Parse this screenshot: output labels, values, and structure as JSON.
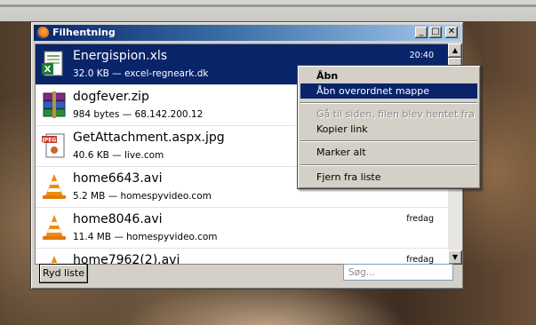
{
  "window": {
    "title": "Filhentning"
  },
  "downloads": [
    {
      "name": "Energispion.xls",
      "meta": "32.0 KB — excel-regneark.dk",
      "time": "20:40",
      "icon": "excel-file-icon",
      "selected": true
    },
    {
      "name": "dogfever.zip",
      "meta": "984 bytes — 68.142.200.12",
      "time": "",
      "icon": "winrar-archive-icon",
      "selected": false
    },
    {
      "name": "GetAttachment.aspx.jpg",
      "meta": "40.6 KB — live.com",
      "time": "",
      "icon": "jpeg-file-icon",
      "selected": false
    },
    {
      "name": "home6643.avi",
      "meta": "5.2 MB — homespyvideo.com",
      "time": "",
      "icon": "vlc-cone-icon",
      "selected": false
    },
    {
      "name": "home8046.avi",
      "meta": "11.4 MB — homespyvideo.com",
      "time": "fredag",
      "icon": "vlc-cone-icon",
      "selected": false
    },
    {
      "name": "home7962(2).avi",
      "meta": "",
      "time": "fredag",
      "icon": "vlc-cone-icon",
      "selected": false
    }
  ],
  "context_menu": {
    "items": [
      {
        "label": "Åbn",
        "bold": true,
        "highlighted": false,
        "disabled": false
      },
      {
        "label": "Åbn overordnet mappe",
        "bold": false,
        "highlighted": true,
        "disabled": false
      },
      {
        "label": "Gå til siden, filen blev hentet fra",
        "bold": false,
        "highlighted": false,
        "disabled": true
      },
      {
        "label": "Kopier link",
        "bold": false,
        "highlighted": false,
        "disabled": false
      },
      {
        "label": "Marker alt",
        "bold": false,
        "highlighted": false,
        "disabled": false
      },
      {
        "label": "Fjern fra liste",
        "bold": false,
        "highlighted": false,
        "disabled": false
      }
    ]
  },
  "toolbar": {
    "clear_label": "Ryd liste"
  },
  "search": {
    "placeholder": "Søg..."
  },
  "colors": {
    "selection": "#0a246a",
    "titlebar_start": "#0a246a",
    "titlebar_end": "#a6caf0"
  }
}
